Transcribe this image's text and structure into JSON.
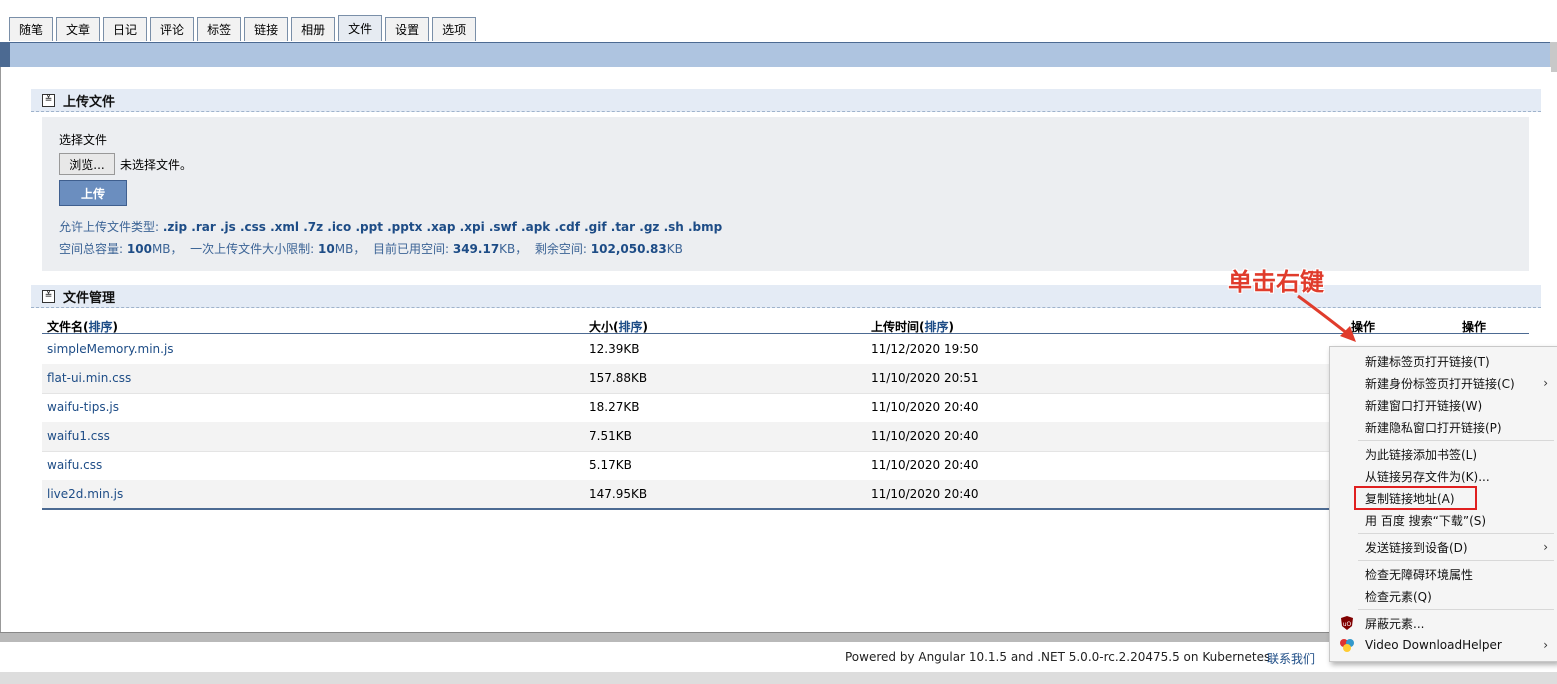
{
  "tabs": [
    "随笔",
    "文章",
    "日记",
    "评论",
    "标签",
    "链接",
    "相册",
    "文件",
    "设置",
    "选项"
  ],
  "active_tab": "文件",
  "upload": {
    "section_title": "上传文件",
    "choose_label": "选择文件",
    "browse_label": "浏览...",
    "no_file_label": "未选择文件。",
    "upload_button": "上传",
    "allowed_label": "允许上传文件类型:",
    "allowed_types": ".zip .rar .js .css .xml .7z .ico .ppt .pptx .xap .xpi .swf .apk .cdf .gif .tar .gz .sh .bmp",
    "total_label": "空间总容量:",
    "total_value": "100",
    "total_unit": "MB，",
    "limit_label": "一次上传文件大小限制:",
    "limit_value": "10",
    "limit_unit": "MB，",
    "used_label": "目前已用空间:",
    "used_value": "349.17",
    "used_unit": "KB，",
    "remain_label": "剩余空间:",
    "remain_value": "102,050.83",
    "remain_unit": "KB"
  },
  "files": {
    "section_title": "文件管理",
    "col_name": "文件名(",
    "col_size": "大小(",
    "col_time": "上传时间(",
    "sort_label": "排序",
    "close_paren": ")",
    "col_op1": "操作",
    "col_op2": "操作",
    "rows": [
      {
        "name": "simpleMemory.min.js",
        "size": "12.39KB",
        "time": "11/12/2020 19:50"
      },
      {
        "name": "flat-ui.min.css",
        "size": "157.88KB",
        "time": "11/10/2020 20:51"
      },
      {
        "name": "waifu-tips.js",
        "size": "18.27KB",
        "time": "11/10/2020 20:40"
      },
      {
        "name": "waifu1.css",
        "size": "7.51KB",
        "time": "11/10/2020 20:40"
      },
      {
        "name": "waifu.css",
        "size": "5.17KB",
        "time": "11/10/2020 20:40"
      },
      {
        "name": "live2d.min.js",
        "size": "147.95KB",
        "time": "11/10/2020 20:40"
      }
    ]
  },
  "annotation": "单击右键",
  "context_menu": {
    "items": [
      "新建标签页打开链接(T)",
      "新建身份标签页打开链接(C)",
      "新建窗口打开链接(W)",
      "新建隐私窗口打开链接(P)",
      "为此链接添加书签(L)",
      "从链接另存文件为(K)...",
      "复制链接地址(A)",
      "用 百度 搜索“下载”(S)",
      "发送链接到设备(D)",
      "检查无障碍环境属性",
      "检查元素(Q)",
      "屏蔽元素...",
      "Video DownloadHelper"
    ]
  },
  "footer": {
    "powered": "Powered by Angular 10.1.5 and .NET 5.0.0-rc.2.20475.5 on Kubernetes",
    "contact": "联系我们"
  },
  "colors": {
    "accent": "#1d4c86",
    "highlight": "#e02020",
    "annot": "#e03c2c"
  }
}
